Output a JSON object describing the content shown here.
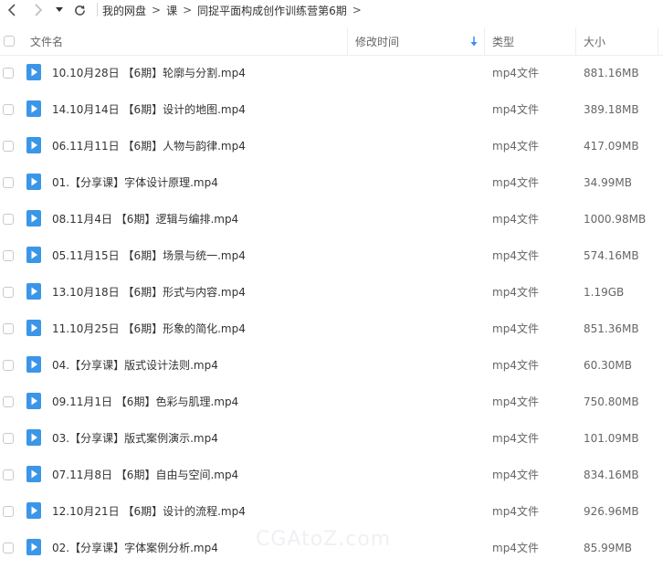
{
  "colors": {
    "accent": "#3b8cf0",
    "icon_blue": "#3b96e8",
    "text": "#333333",
    "muted": "#666666"
  },
  "nav": {
    "back_icon": "chevron-left-icon",
    "forward_icon": "chevron-right-icon",
    "dropdown_icon": "caret-down-icon",
    "refresh_icon": "refresh-icon",
    "breadcrumbs": [
      "我的网盘",
      "课",
      "同捉平面构成创作训练营第6期"
    ],
    "separator": ">"
  },
  "header": {
    "name": "文件名",
    "modified": "修改时间",
    "type": "类型",
    "size": "大小",
    "sort_icon": "sort-down-arrow-icon"
  },
  "files": [
    {
      "name": "10.10月28日 【6期】轮廓与分割.mp4",
      "type": "mp4文件",
      "size": "881.16MB"
    },
    {
      "name": "14.10月14日 【6期】设计的地图.mp4",
      "type": "mp4文件",
      "size": "389.18MB"
    },
    {
      "name": "06.11月11日 【6期】人物与韵律.mp4",
      "type": "mp4文件",
      "size": "417.09MB"
    },
    {
      "name": "01.【分享课】字体设计原理.mp4",
      "type": "mp4文件",
      "size": "34.99MB"
    },
    {
      "name": "08.11月4日 【6期】逻辑与编排.mp4",
      "type": "mp4文件",
      "size": "1000.98MB"
    },
    {
      "name": "05.11月15日 【6期】场景与统一.mp4",
      "type": "mp4文件",
      "size": "574.16MB"
    },
    {
      "name": "13.10月18日 【6期】形式与内容.mp4",
      "type": "mp4文件",
      "size": "1.19GB"
    },
    {
      "name": "11.10月25日 【6期】形象的简化.mp4",
      "type": "mp4文件",
      "size": "851.36MB"
    },
    {
      "name": "04.【分享课】版式设计法则.mp4",
      "type": "mp4文件",
      "size": "60.30MB"
    },
    {
      "name": "09.11月1日 【6期】色彩与肌理.mp4",
      "type": "mp4文件",
      "size": "750.80MB"
    },
    {
      "name": "03.【分享课】版式案例演示.mp4",
      "type": "mp4文件",
      "size": "101.09MB"
    },
    {
      "name": "07.11月8日 【6期】自由与空间.mp4",
      "type": "mp4文件",
      "size": "834.16MB"
    },
    {
      "name": "12.10月21日 【6期】设计的流程.mp4",
      "type": "mp4文件",
      "size": "926.96MB"
    },
    {
      "name": "02.【分享课】字体案例分析.mp4",
      "type": "mp4文件",
      "size": "85.99MB"
    }
  ],
  "watermark": "CGAtoZ.com"
}
